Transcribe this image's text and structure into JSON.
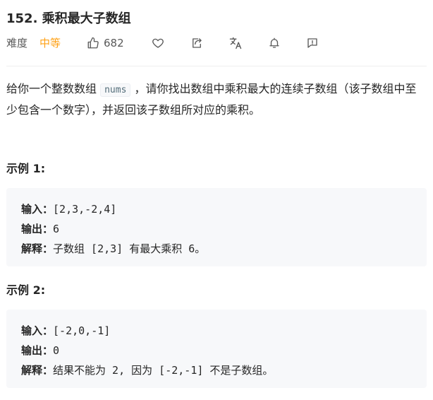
{
  "problem": {
    "title": "152. 乘积最大子数组",
    "difficulty_label": "难度",
    "difficulty": "中等",
    "likes": "682"
  },
  "actions": [
    {
      "name": "thumbs-up-icon"
    },
    {
      "name": "heart-icon"
    },
    {
      "name": "share-icon"
    },
    {
      "name": "translate-icon"
    },
    {
      "name": "bell-icon"
    },
    {
      "name": "feedback-icon"
    }
  ],
  "description": {
    "part1": "给你一个整数数组 ",
    "code": "nums",
    "part2": " ，请你找出数组中乘积最大的连续子数组（该子数组中至少包含一个数字），并返回该子数组所对应的乘积。"
  },
  "examples": [
    {
      "title": "示例 1:",
      "input_label": "输入：",
      "input": "[2,3,-2,4]",
      "output_label": "输出：",
      "output": "6",
      "explain_label": "解释：",
      "explain": "子数组 [2,3] 有最大乘积 6。"
    },
    {
      "title": "示例 2:",
      "input_label": "输入：",
      "input": "[-2,0,-1]",
      "output_label": "输出：",
      "output": "0",
      "explain_label": "解释：",
      "explain": "结果不能为 2, 因为 [-2,-1] 不是子数组。"
    }
  ],
  "colors": {
    "difficulty_medium": "#ffa116",
    "text": "#262626",
    "muted": "#595959",
    "example_bg": "#f7f8fa"
  }
}
